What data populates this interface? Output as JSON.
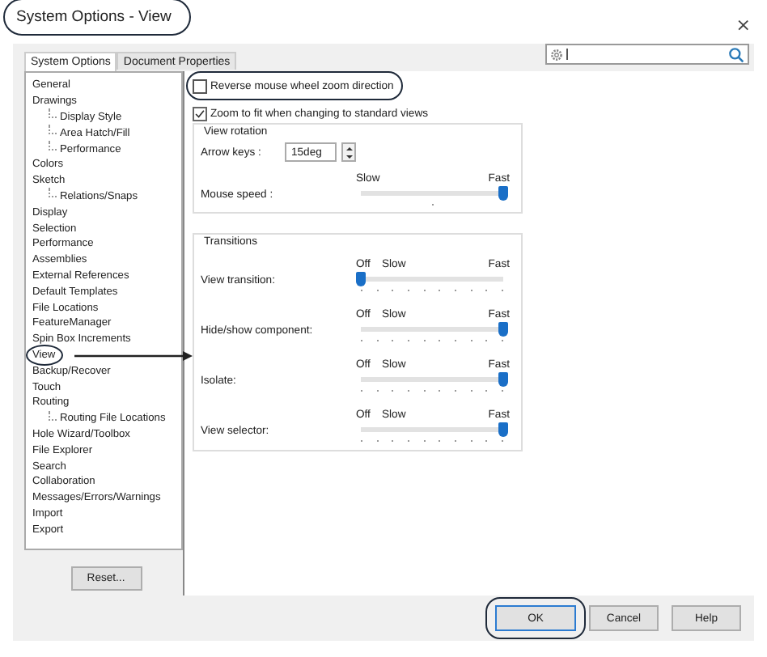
{
  "window": {
    "title": "System Options - View",
    "title_circled": true,
    "close": "×"
  },
  "tabs": [
    {
      "label": "System Options",
      "selected": true
    },
    {
      "label": "Document Properties",
      "selected": false
    }
  ],
  "tree": [
    {
      "label": "General",
      "circled": false
    },
    {
      "label": "Drawings",
      "circled": false,
      "children": [
        {
          "label": "Display Style",
          "circled": false
        },
        {
          "label": "Area Hatch/Fill",
          "circled": false
        },
        {
          "label": "Performance",
          "circled": false
        }
      ]
    },
    {
      "label": "Colors",
      "circled": false
    },
    {
      "label": "Sketch",
      "circled": false,
      "children": [
        {
          "label": "Relations/Snaps",
          "circled": false
        }
      ]
    },
    {
      "label": "Display",
      "circled": false
    },
    {
      "label": "Selection",
      "circled": false
    },
    {
      "label": "Performance",
      "circled": false
    },
    {
      "label": "Assemblies",
      "circled": false
    },
    {
      "label": "External References",
      "circled": false
    },
    {
      "label": "Default Templates",
      "circled": false
    },
    {
      "label": "File Locations",
      "circled": false
    },
    {
      "label": "FeatureManager",
      "circled": false
    },
    {
      "label": "Spin Box Increments",
      "circled": false
    },
    {
      "label": "View",
      "circled": true
    },
    {
      "label": "Backup/Recover",
      "circled": false
    },
    {
      "label": "Touch",
      "circled": false
    },
    {
      "label": "Routing",
      "circled": false,
      "children": [
        {
          "label": "Routing File Locations",
          "circled": false
        }
      ]
    },
    {
      "label": "Hole Wizard/Toolbox",
      "circled": false
    },
    {
      "label": "File Explorer",
      "circled": false
    },
    {
      "label": "Search",
      "circled": false
    },
    {
      "label": "Collaboration",
      "circled": false
    },
    {
      "label": "Messages/Errors/Warnings",
      "circled": false
    },
    {
      "label": "Import",
      "circled": false
    },
    {
      "label": "Export",
      "circled": false
    }
  ],
  "reset_button": "Reset...",
  "checkboxes": [
    {
      "label": "Reverse mouse wheel zoom direction",
      "checked": false,
      "circled": true
    },
    {
      "label": "Zoom to fit when changing to standard views",
      "checked": true,
      "circled": false
    }
  ],
  "view_rotation": {
    "title": "View rotation",
    "arrow_keys": {
      "label": "Arrow keys :",
      "value": "15deg"
    },
    "sliders": [
      {
        "label": "Mouse speed :",
        "scale": [
          "Slow",
          "Fast"
        ],
        "level": 1
      }
    ]
  },
  "transitions": {
    "title": "Transitions",
    "sliders": [
      {
        "label": "View transition:",
        "scale": [
          "Off",
          "Slow",
          "Fast"
        ],
        "level": 0
      },
      {
        "label": "Hide/show component:",
        "scale": [
          "Off",
          "Slow",
          "Fast"
        ],
        "level": 1
      },
      {
        "label": "Isolate:",
        "scale": [
          "Off",
          "Slow",
          "Fast"
        ],
        "level": 1
      },
      {
        "label": "View selector:",
        "scale": [
          "Off",
          "Slow",
          "Fast"
        ],
        "level": 1
      }
    ]
  },
  "buttons": [
    {
      "label": "OK",
      "circled": true
    },
    {
      "label": "Cancel",
      "circled": false
    },
    {
      "label": "Help",
      "circled": false
    }
  ]
}
